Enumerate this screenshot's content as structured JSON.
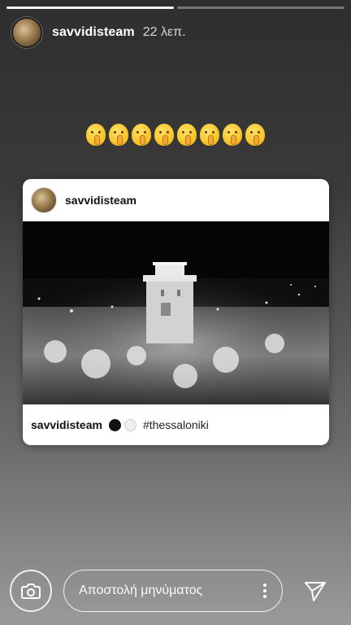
{
  "story": {
    "segments_total": 2,
    "segments_done": 1
  },
  "header": {
    "username": "savvidisteam",
    "time": "22 λεπ."
  },
  "emojis": {
    "count": 8,
    "icon": "shushing-face-emoji"
  },
  "post": {
    "username": "savvidisteam",
    "image": "white-tower-night-crowd-photo",
    "caption": {
      "username": "savvidisteam",
      "emoji_1": "black-circle",
      "emoji_2": "white-circle",
      "hashtag": "#thessaloniki"
    }
  },
  "footer": {
    "camera_icon": "camera-icon",
    "message_placeholder": "Αποστολή μηνύματος",
    "more_icon": "more-vertical-icon",
    "send_icon": "send-icon"
  }
}
